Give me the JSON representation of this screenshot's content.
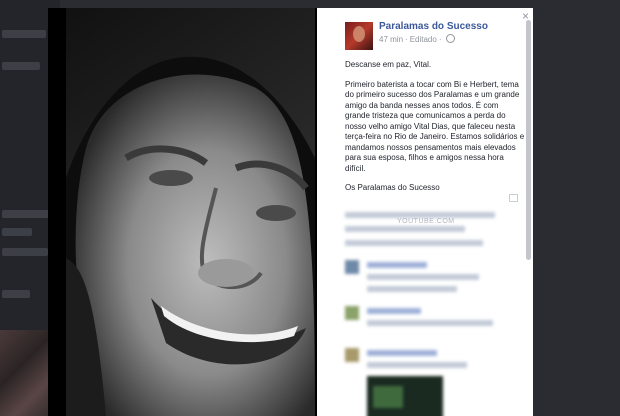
{
  "post": {
    "page_name": "Paralamas do Sucesso",
    "time": "47 min",
    "edited": "Editado",
    "separator": "·",
    "title_line": "Descanse em paz, Vital.",
    "body": "Primeiro baterista a tocar com Bi e Herbert, tema do primeiro sucesso dos Paralamas e um grande amigo da banda nesses anos todos. É com grande tristeza que comunicamos a perda do nosso velho amigo Vital Dias, que faleceu nesta terça-feira no Rio de Janeiro. Estamos solidários e mandamos nossos pensamentos mais elevados para sua esposa, filhos e amigos nessa hora difícil.",
    "signature": "Os Paralamas do Sucesso"
  },
  "lightbox": {
    "close_glyph": "×",
    "video_source": "YOUTUBE.COM"
  },
  "icons": {
    "close": "close-icon",
    "privacy": "globe-icon",
    "options": "options-icon"
  },
  "colors": {
    "link": "#3b5998",
    "meta": "#90949c",
    "overlay": "#1d1f23"
  }
}
